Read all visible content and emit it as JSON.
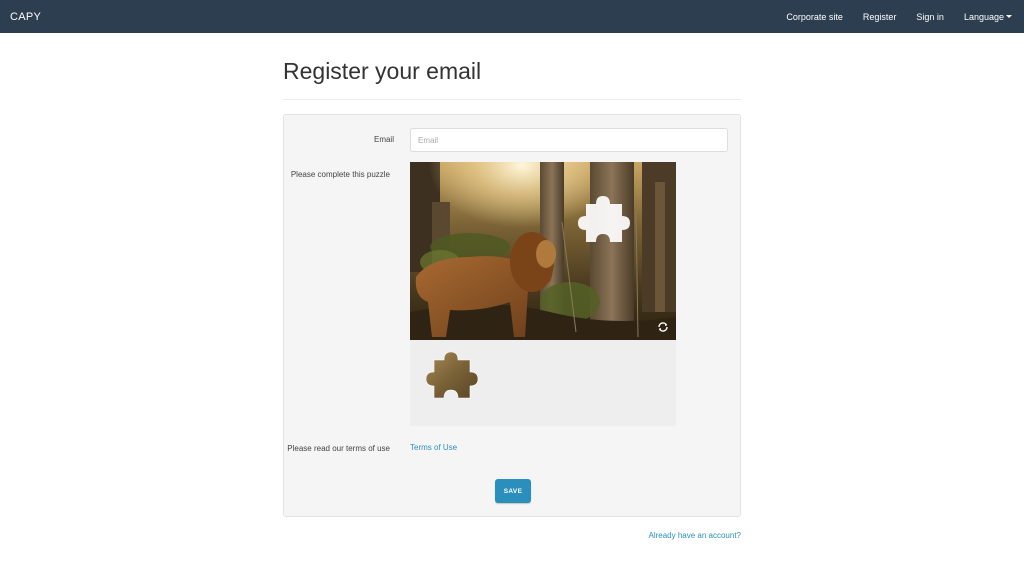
{
  "navbar": {
    "brand": "CAPY",
    "links": [
      {
        "label": "Corporate site"
      },
      {
        "label": "Register"
      },
      {
        "label": "Sign in"
      },
      {
        "label": "Language"
      }
    ]
  },
  "page": {
    "title": "Register your email"
  },
  "form": {
    "email_label": "Email",
    "email_placeholder": "Email",
    "email_value": "",
    "puzzle_label": "Please complete this puzzle",
    "terms_label": "Please read our terms of use",
    "terms_link": "Terms of Use",
    "save_label": "SAVE"
  },
  "footer": {
    "account_link": "Already have an account?"
  },
  "colors": {
    "navbar_bg": "#2c3e50",
    "accent": "#2a8fbd",
    "panel_bg": "#f5f5f5"
  },
  "icons": {
    "refresh": "refresh-icon",
    "dropdown": "caret-down-icon"
  }
}
